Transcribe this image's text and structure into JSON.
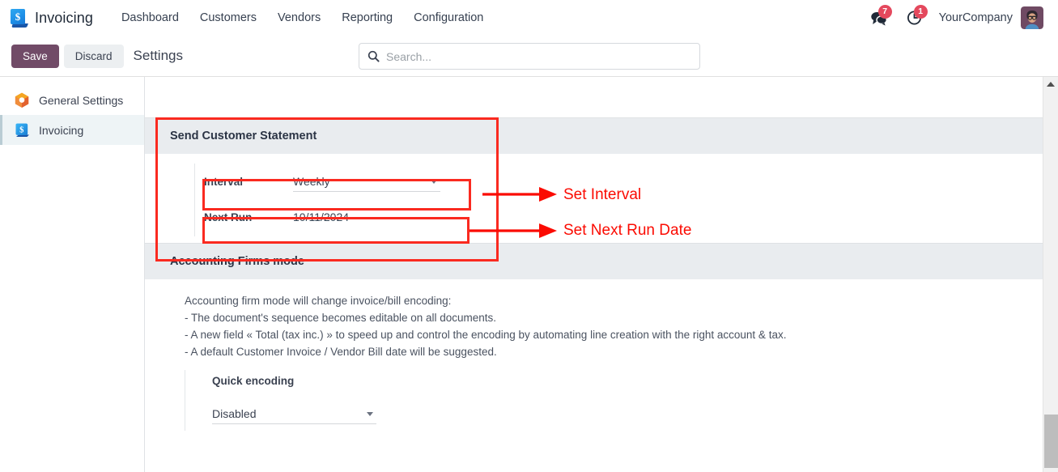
{
  "navbar": {
    "app_icon": "invoicing-app-icon",
    "brand": "Invoicing",
    "menu": [
      {
        "label": "Dashboard"
      },
      {
        "label": "Customers"
      },
      {
        "label": "Vendors"
      },
      {
        "label": "Reporting"
      },
      {
        "label": "Configuration"
      }
    ],
    "messages_icon": "messages-icon",
    "messages_count": "7",
    "activities_icon": "activities-clock-icon",
    "activities_count": "1",
    "company": "YourCompany",
    "avatar_icon": "user-avatar"
  },
  "control_panel": {
    "save_label": "Save",
    "discard_label": "Discard",
    "title": "Settings"
  },
  "search": {
    "icon": "search-icon",
    "placeholder": "Search...",
    "value": ""
  },
  "sidebar": {
    "items": [
      {
        "label": "General Settings",
        "icon": "general-settings-icon",
        "active": false
      },
      {
        "label": "Invoicing",
        "icon": "invoicing-icon",
        "active": true
      }
    ]
  },
  "sections": {
    "customer_statement": {
      "title": "Send Customer Statement",
      "interval": {
        "label": "Interval",
        "value": "Weekly",
        "caret": "chevron-down-icon"
      },
      "next_run": {
        "label": "Next Run",
        "value": "10/11/2024"
      }
    },
    "accounting_firms": {
      "title": "Accounting Firms mode",
      "description_lines": [
        "Accounting firm mode will change invoice/bill encoding:",
        "- The document's sequence becomes editable on all documents.",
        "- A new field « Total (tax inc.) » to speed up and control the encoding by automating line creation with the right account & tax.",
        "- A default Customer Invoice / Vendor Bill date will be suggested."
      ],
      "quick_encoding": {
        "label": "Quick encoding",
        "value": "Disabled",
        "caret": "chevron-down-icon"
      }
    }
  },
  "annotations": {
    "color": "#fb0b02",
    "items": [
      {
        "text": "Set Interval"
      },
      {
        "text": "Set Next Run Date"
      }
    ]
  },
  "scrollbar": {
    "up_arrow": "scroll-up-arrow-icon"
  }
}
